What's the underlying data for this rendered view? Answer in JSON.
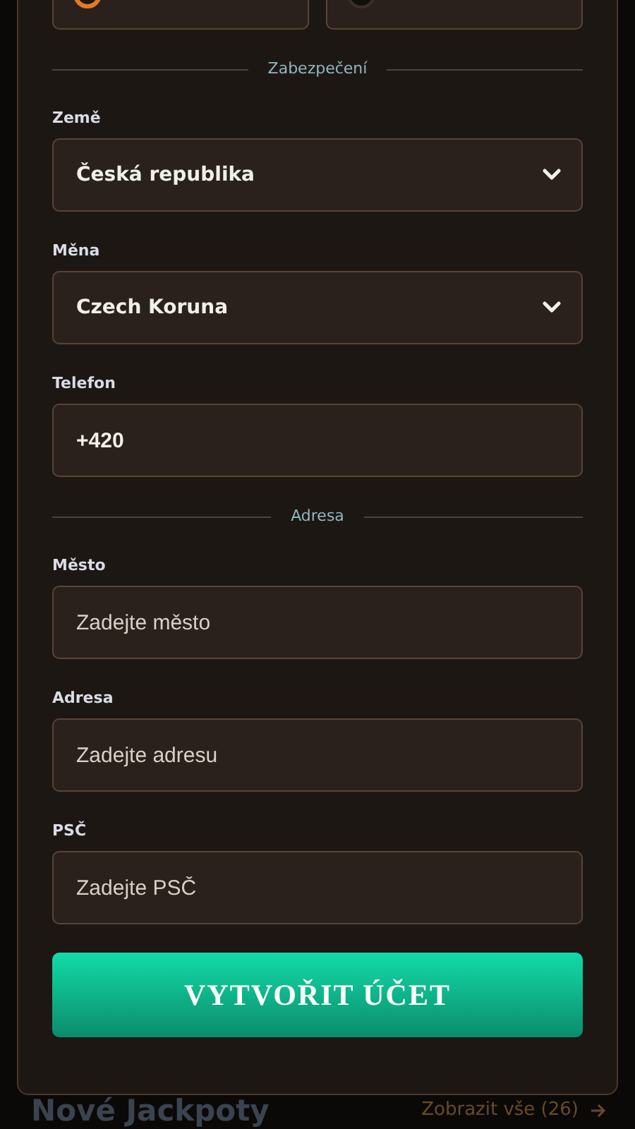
{
  "gender_options": [
    {
      "selected": true
    },
    {
      "selected": false
    }
  ],
  "sections": [
    {
      "divider": "Zabezpečení",
      "fields": [
        {
          "label": "Země",
          "kind": "select",
          "value": "Česká republika"
        },
        {
          "label": "Měna",
          "kind": "select",
          "value": "Czech Koruna"
        },
        {
          "label": "Telefon",
          "kind": "input",
          "value": "+420"
        }
      ]
    },
    {
      "divider": "Adresa",
      "fields": [
        {
          "label": "Město",
          "kind": "input",
          "placeholder": "Zadejte město"
        },
        {
          "label": "Adresa",
          "kind": "input",
          "placeholder": "Zadejte adresu"
        },
        {
          "label": "PSČ",
          "kind": "input",
          "placeholder": "Zadejte PSČ"
        }
      ]
    }
  ],
  "submit_button": "VYTVOŘIT ÚČET",
  "behind": {
    "heading": "Nové Jackpoty",
    "link": "Zobrazit vše (26)"
  }
}
